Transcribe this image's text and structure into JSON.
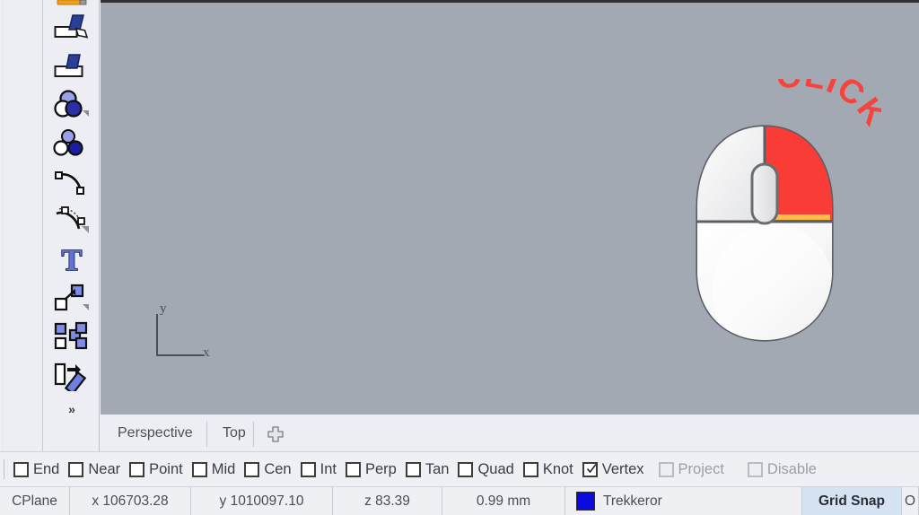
{
  "app": {
    "viewport_bg": "#a3a9b3",
    "panel_bg": "#eef0f4",
    "accent_blue": "#4a63c8",
    "click_red": "#f8423c"
  },
  "toolbar": {
    "name": "main-vertical-toolbar",
    "items": [
      {
        "id": "partial-top",
        "icon": "orange-partial-icon",
        "tooltip": ""
      },
      {
        "id": "cap-planar-holes",
        "icon": "cap-planar-holes-icon",
        "tooltip": ""
      },
      {
        "id": "extract-surface",
        "icon": "extract-surface-icon",
        "tooltip": ""
      },
      {
        "id": "boolean-union",
        "icon": "boolean-union-icon",
        "tooltip": ""
      },
      {
        "id": "boolean-split",
        "icon": "boolean-split-icon",
        "tooltip": ""
      },
      {
        "id": "curve-edit",
        "icon": "curve-control-points-icon",
        "tooltip": ""
      },
      {
        "id": "curve-rebuild",
        "icon": "curve-rebuild-icon",
        "tooltip": ""
      },
      {
        "id": "text-object",
        "icon": "text-tool-icon",
        "tooltip": ""
      },
      {
        "id": "move-object",
        "icon": "move-object-icon",
        "tooltip": ""
      },
      {
        "id": "array-object",
        "icon": "array-object-icon",
        "tooltip": ""
      },
      {
        "id": "rotate-object",
        "icon": "rotate-object-icon",
        "tooltip": ""
      }
    ],
    "more_label": "»"
  },
  "viewport": {
    "name": "perspective-viewport",
    "axis": {
      "x_label": "x",
      "y_label": "y"
    },
    "annotation": {
      "text": "CLICK",
      "color": "#f8423c"
    },
    "mouse_hint": {
      "name": "mouse-right-click-illustration",
      "highlighted_button": "right"
    }
  },
  "tabs": {
    "items": [
      {
        "label": "Perspective",
        "active": false
      },
      {
        "label": "Top",
        "active": true
      }
    ],
    "add_label": "+"
  },
  "osnap": {
    "items": [
      {
        "label": "End",
        "checked": false,
        "disabled": false
      },
      {
        "label": "Near",
        "checked": false,
        "disabled": false
      },
      {
        "label": "Point",
        "checked": false,
        "disabled": false
      },
      {
        "label": "Mid",
        "checked": false,
        "disabled": false
      },
      {
        "label": "Cen",
        "checked": false,
        "disabled": false
      },
      {
        "label": "Int",
        "checked": false,
        "disabled": false
      },
      {
        "label": "Perp",
        "checked": false,
        "disabled": false
      },
      {
        "label": "Tan",
        "checked": false,
        "disabled": false
      },
      {
        "label": "Quad",
        "checked": false,
        "disabled": false
      },
      {
        "label": "Knot",
        "checked": false,
        "disabled": false
      },
      {
        "label": "Vertex",
        "checked": true,
        "disabled": false
      },
      {
        "label": "Project",
        "checked": false,
        "disabled": true
      },
      {
        "label": "Disable",
        "checked": false,
        "disabled": true
      }
    ]
  },
  "statusbar": {
    "cplane": "CPlane",
    "x": "x 106703.28",
    "y": "y 1010097.10",
    "z": "z 83.39",
    "units": "0.99 mm",
    "layer_color": "#0b0be0",
    "layer_name": "Trekkeror",
    "grid_snap": "Grid Snap",
    "ortho_partial": "O"
  }
}
